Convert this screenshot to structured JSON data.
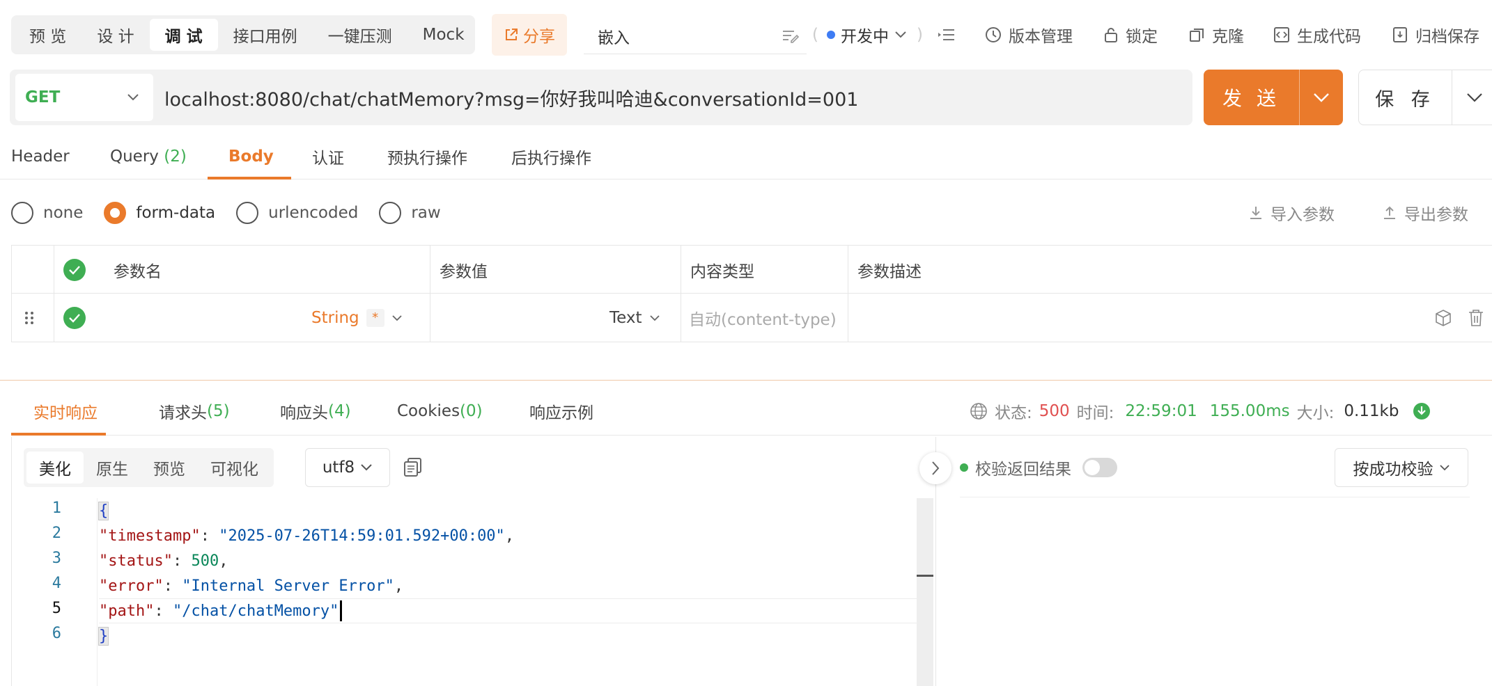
{
  "mode_tabs": [
    "预 览",
    "设 计",
    "调 试",
    "接口用例",
    "一键压测",
    "Mock"
  ],
  "share_label": "分享",
  "embed_label": "嵌入",
  "env_label": "开发中",
  "toolbar": {
    "version": "版本管理",
    "lock": "锁定",
    "clone": "克隆",
    "gen_code": "生成代码",
    "archive": "归档保存"
  },
  "request": {
    "method": "GET",
    "url": "localhost:8080/chat/chatMemory?msg=你好我叫哈迪&conversationId=001",
    "send_label": "发 送",
    "save_label": "保 存"
  },
  "req_tabs": {
    "header": "Header",
    "query": "Query",
    "query_count": "(2)",
    "body": "Body",
    "auth": "认证",
    "pre": "预执行操作",
    "post": "后执行操作"
  },
  "body_types": [
    "none",
    "form-data",
    "urlencoded",
    "raw"
  ],
  "io": {
    "import": "导入参数",
    "export": "导出参数"
  },
  "params_table": {
    "headers": [
      "参数名",
      "参数值",
      "内容类型",
      "参数描述"
    ],
    "row": {
      "type": "String",
      "required": "*",
      "value_type": "Text",
      "content_type": "自动(content-type)"
    }
  },
  "resp_tabs": {
    "live": "实时响应",
    "req_headers": "请求头",
    "req_headers_count": "(5)",
    "resp_headers": "响应头",
    "resp_headers_count": "(4)",
    "cookies": "Cookies",
    "cookies_count": "(0)",
    "example": "响应示例"
  },
  "status": {
    "status_label": "状态:",
    "status_value": "500",
    "time_label": "时间:",
    "time_value": "22:59:01",
    "duration": "155.00ms",
    "size_label": "大小:",
    "size_value": "0.11kb"
  },
  "view_tabs": [
    "美化",
    "原生",
    "预览",
    "可视化"
  ],
  "encoding": "utf8",
  "validate_label": "校验返回结果",
  "success_check": "按成功校验",
  "code": {
    "line_numbers": [
      "1",
      "2",
      "3",
      "4",
      "5",
      "6"
    ],
    "open_brace": "{",
    "close_brace": "}",
    "k_timestamp": "\"timestamp\"",
    "v_timestamp": "\"2025-07-26T14:59:01.592+00:00\"",
    "k_status": "\"status\"",
    "v_status": "500",
    "k_error": "\"error\"",
    "v_error": "\"Internal Server Error\"",
    "k_path": "\"path\"",
    "v_path": "\"/chat/chatMemory\""
  },
  "colors": {
    "accent": "#ea7a2b",
    "success": "#3fae53",
    "error": "#e05050",
    "env_dot": "#3e7cf4"
  }
}
